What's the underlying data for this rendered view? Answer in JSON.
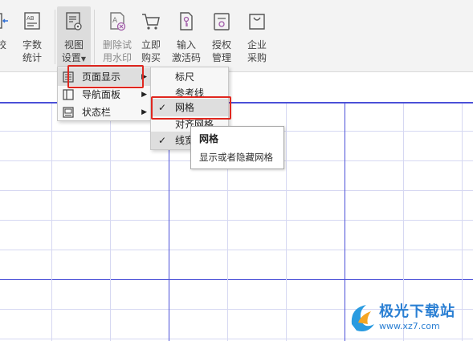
{
  "ribbon": {
    "buttons": [
      {
        "label": "校",
        "icon": "compare-icon"
      },
      {
        "label": "字数\n统计",
        "icon": "word-count-icon"
      },
      {
        "label": "视图\n设置",
        "icon": "view-settings-icon"
      },
      {
        "label": "删除试\n用水印",
        "icon": "remove-watermark-icon"
      },
      {
        "label": "立即\n购买",
        "icon": "cart-icon"
      },
      {
        "label": "输入\n激活码",
        "icon": "key-icon"
      },
      {
        "label": "授权\n管理",
        "icon": "license-icon"
      },
      {
        "label": "企业\n采购",
        "icon": "bag-icon"
      }
    ],
    "view_settings_line1": "视图",
    "view_settings_line2": "设置",
    "compare_label": "校",
    "word_count_line1": "字数",
    "word_count_line2": "统计",
    "remove_wm_line1": "删除试",
    "remove_wm_line2": "用水印",
    "buy_line1": "立即",
    "buy_line2": "购买",
    "activate_line1": "输入",
    "activate_line2": "激活码",
    "license_line1": "授权",
    "license_line2": "管理",
    "enterprise_line1": "企业",
    "enterprise_line2": "采购"
  },
  "menu_main": {
    "items": [
      {
        "label": "页面显示",
        "icon": "page-display-icon",
        "has_submenu": true
      },
      {
        "label": "导航面板",
        "icon": "nav-panel-icon",
        "has_submenu": true
      },
      {
        "label": "状态栏",
        "icon": "status-bar-icon",
        "has_submenu": true
      }
    ]
  },
  "menu_sub": {
    "items": [
      {
        "label": "标尺",
        "checked": false
      },
      {
        "label": "参考线",
        "checked": false
      },
      {
        "label": "网格",
        "checked": true
      },
      {
        "label": "对齐网格",
        "checked": false
      },
      {
        "label": "线宽",
        "checked": true
      }
    ]
  },
  "tooltip": {
    "title": "网格",
    "description": "显示或者隐藏网格"
  },
  "watermark": {
    "line1": "极光下载站",
    "line2": "www.xz7.com"
  },
  "colors": {
    "grid_major": "#4b50d8",
    "grid_minor": "#d6d8f2",
    "highlight_box": "#e0271f",
    "ribbon_bg": "#f3f3f3",
    "watermark": "#2a7fd3"
  }
}
